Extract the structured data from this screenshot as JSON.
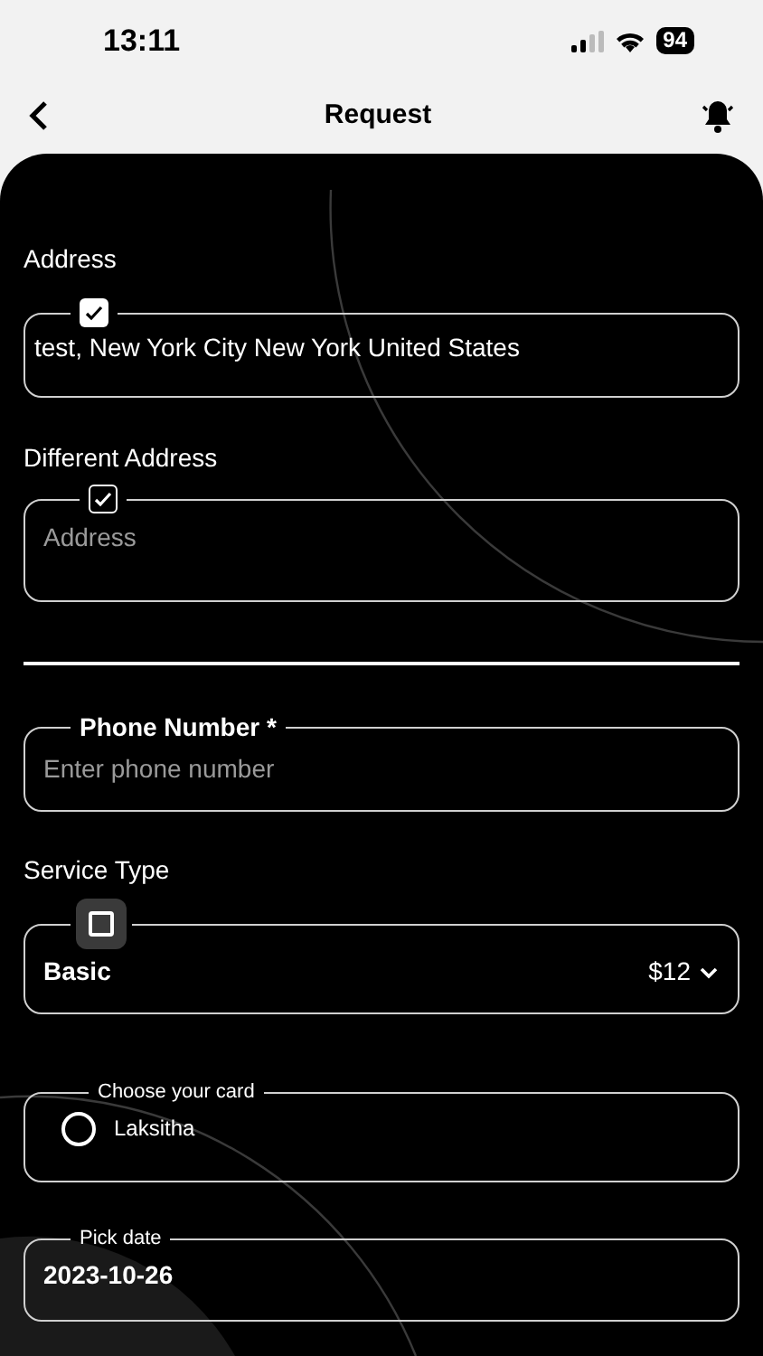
{
  "status_bar": {
    "time": "13:11",
    "battery": "94"
  },
  "header": {
    "title": "Request"
  },
  "address": {
    "label": "Address",
    "checkbox": {
      "checked": true,
      "kind": "filled"
    },
    "value": "test, New York City New York United States"
  },
  "different_address": {
    "label": "Different Address",
    "checkbox": {
      "checked": true,
      "kind": "outline"
    },
    "placeholder": "Address"
  },
  "phone": {
    "legend": "Phone Number *",
    "placeholder": "Enter phone number"
  },
  "service_type": {
    "label": "Service Type",
    "checkbox": {
      "checked": false,
      "kind": "boxed"
    },
    "value": "Basic",
    "price": "$12"
  },
  "card": {
    "legend": "Choose your card",
    "options": [
      {
        "label": "Laksitha",
        "selected": false
      }
    ]
  },
  "date": {
    "legend": "Pick date",
    "value": "2023-10-26"
  }
}
